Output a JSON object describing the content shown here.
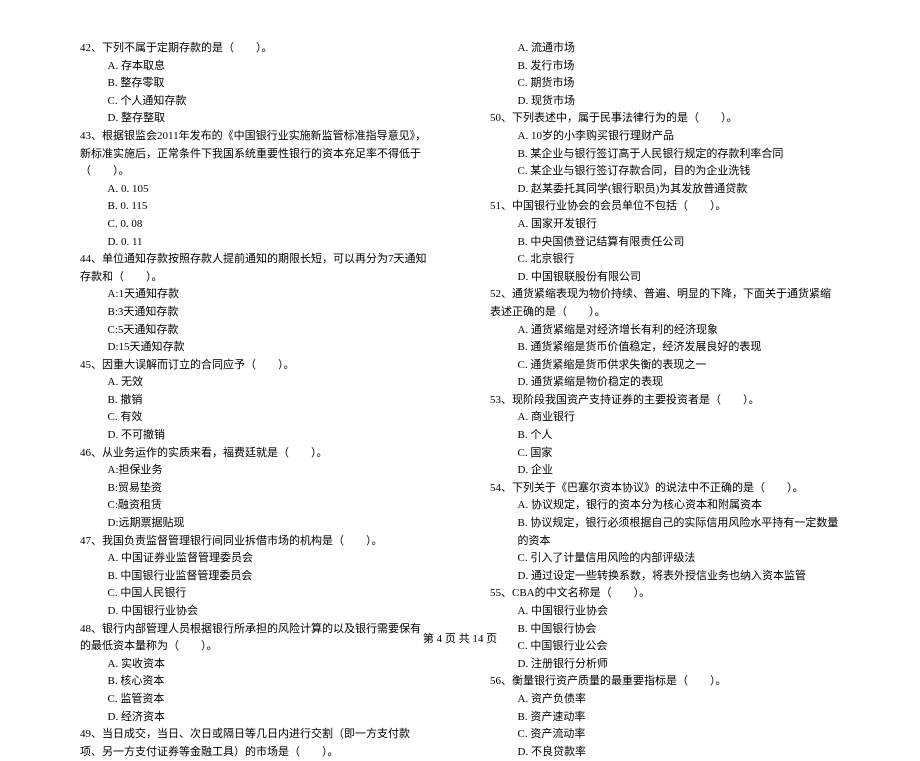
{
  "footer": "第 4 页 共 14 页",
  "left": {
    "q42": {
      "stem": "42、下列不属于定期存款的是（　　）。",
      "a": "A. 存本取息",
      "b": "B. 整存零取",
      "c": "C. 个人通知存款",
      "d": "D. 整存整取"
    },
    "q43": {
      "stem": "43、根据银监会2011年发布的《中国银行业实施新监管标准指导意见》，新标准实施后，正常条件下我国系统重要性银行的资本充足率不得低于（　　）。",
      "a": "A. 0. 105",
      "b": "B. 0. 115",
      "c": "C. 0. 08",
      "d": "D. 0. 11"
    },
    "q44": {
      "stem": "44、单位通知存款按照存款人提前通知的期限长短，可以再分为7天通知存款和（　　）。",
      "a": "A:1天通知存款",
      "b": "B:3天通知存款",
      "c": "C:5天通知存款",
      "d": "D:15天通知存款"
    },
    "q45": {
      "stem": "45、因重大误解而订立的合同应予（　　）。",
      "a": "A. 无效",
      "b": "B. 撤销",
      "c": "C. 有效",
      "d": "D. 不可撤销"
    },
    "q46": {
      "stem": "46、从业务运作的实质来看，福费廷就是（　　）。",
      "a": "A:担保业务",
      "b": "B:贸易垫资",
      "c": "C:融资租赁",
      "d": "D:远期票据贴现"
    },
    "q47": {
      "stem": "47、我国负责监督管理银行间同业拆借市场的机构是（　　）。",
      "a": "A. 中国证券业监督管理委员会",
      "b": "B. 中国银行业监督管理委员会",
      "c": "C. 中国人民银行",
      "d": "D. 中国银行业协会"
    },
    "q48": {
      "stem": "48、银行内部管理人员根据银行所承担的风险计算的以及银行需要保有的最低资本量称为（　　）。",
      "a": "A. 实收资本",
      "b": "B. 核心资本",
      "c": "C. 监管资本",
      "d": "D. 经济资本"
    },
    "q49": {
      "stem": "49、当日成交，当日、次日或隔日等几日内进行交割（即一方支付款项、另一方支付证券等金融工具）的市场是（　　）。"
    }
  },
  "right": {
    "q49opts": {
      "a": "A. 流通市场",
      "b": "B. 发行市场",
      "c": "C. 期货市场",
      "d": "D. 现货市场"
    },
    "q50": {
      "stem": "50、下列表述中，属于民事法律行为的是（　　）。",
      "a": "A. 10岁的小李购买银行理财产品",
      "b": "B. 某企业与银行签订高于人民银行规定的存款利率合同",
      "c": "C. 某企业与银行签订存款合同，目的为企业洗钱",
      "d": "D. 赵某委托其同学(银行职员)为其发放普通贷款"
    },
    "q51": {
      "stem": "51、中国银行业协会的会员单位不包括（　　）。",
      "a": "A. 国家开发银行",
      "b": "B. 中央国债登记结算有限责任公司",
      "c": "C. 北京银行",
      "d": "D. 中国银联股份有限公司"
    },
    "q52": {
      "stem": "52、通货紧缩表现为物价持续、普遍、明显的下降，下面关于通货紧缩表述正确的是（　　）。",
      "a": "A. 通货紧缩是对经济增长有利的经济现象",
      "b": "B. 通货紧缩是货币价值稳定，经济发展良好的表现",
      "c": "C. 通货紧缩是货币供求失衡的表现之一",
      "d": "D. 通货紧缩是物价稳定的表现"
    },
    "q53": {
      "stem": "53、现阶段我国资产支持证券的主要投资者是（　　）。",
      "a": "A. 商业银行",
      "b": "B. 个人",
      "c": "C. 国家",
      "d": "D. 企业"
    },
    "q54": {
      "stem": "54、下列关于《巴塞尔资本协议》的说法中不正确的是（　　）。",
      "a": "A. 协议规定，银行的资本分为核心资本和附属资本",
      "b": "B. 协议规定，银行必须根据自己的实际信用风险水平持有一定数量的资本",
      "c": "C. 引入了计量信用风险的内部评级法",
      "d": "D. 通过设定一些转换系数，将表外授信业务也纳入资本监管"
    },
    "q55": {
      "stem": "55、CBA的中文名称是（　　）。",
      "a": "A. 中国银行业协会",
      "b": "B. 中国银行协会",
      "c": "C. 中国银行业公会",
      "d": "D. 注册银行分析师"
    },
    "q56": {
      "stem": "56、衡量银行资产质量的最重要指标是（　　）。",
      "a": "A. 资产负债率",
      "b": "B. 资产速动率",
      "c": "C. 资产流动率",
      "d": "D. 不良贷款率"
    }
  }
}
